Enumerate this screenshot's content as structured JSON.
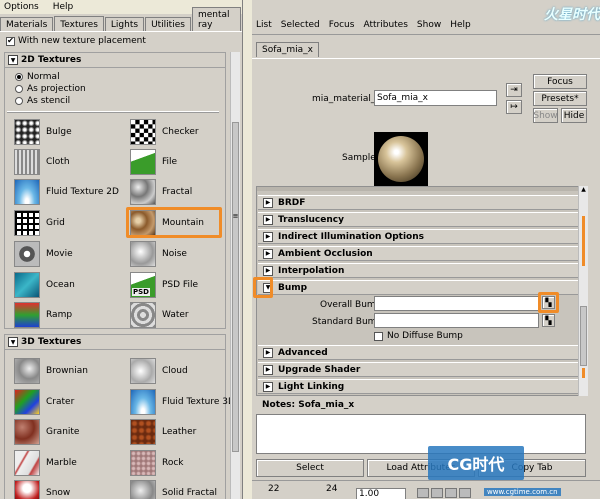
{
  "left": {
    "menu": [
      "Options",
      "Help"
    ],
    "tabs": [
      "Materials",
      "Textures",
      "Lights",
      "Utilities",
      "mental ray"
    ],
    "new_texture_placement": "With new texture placement",
    "sec2d": "2D Textures",
    "radios": [
      "Normal",
      "As projection",
      "As stencil"
    ],
    "tex2d": [
      "Bulge",
      "Checker",
      "Cloth",
      "File",
      "Fluid Texture 2D",
      "Fractal",
      "Grid",
      "Mountain",
      "Movie",
      "Noise",
      "Ocean",
      "PSD File",
      "Ramp",
      "Water"
    ],
    "psd_badge": "PSD",
    "sec3d": "3D Textures",
    "tex3d": [
      "Brownian",
      "Cloud",
      "Crater",
      "Fluid Texture 3D",
      "Granite",
      "Leather",
      "Marble",
      "Rock",
      "Snow",
      "Solid Fractal"
    ]
  },
  "right": {
    "menu": [
      "List",
      "Selected",
      "Focus",
      "Attributes",
      "Show",
      "Help"
    ],
    "tab": "Sofa_mia_x",
    "mat_label": "mia_material_x:",
    "mat_value": "Sofa_mia_x",
    "focus": "Focus",
    "presets": "Presets*",
    "show": "Show",
    "hide": "Hide",
    "sample": "Sample",
    "sections": [
      "BRDF",
      "Translucency",
      "Indirect Illumination Options",
      "Ambient Occlusion",
      "Interpolation",
      "Bump",
      "Advanced",
      "Upgrade Shader",
      "Light Linking"
    ],
    "overall_bump": "Overall Bump",
    "standard_bump": "Standard Bump",
    "no_diffuse_bump": "No Diffuse Bump",
    "notes": "Notes:  Sofa_mia_x",
    "select": "Select",
    "load_attributes": "Load Attributes",
    "copy_tab": "Copy Tab",
    "frame_a": "22",
    "frame_b": "24",
    "time_value": "1.00"
  },
  "watermark": "火星时代",
  "brand": {
    "cg": "CG时代",
    "url": "www.cgtime.com.cn"
  },
  "colors": {
    "highlight": "#f08c28",
    "panel": "#d4d0c8"
  }
}
